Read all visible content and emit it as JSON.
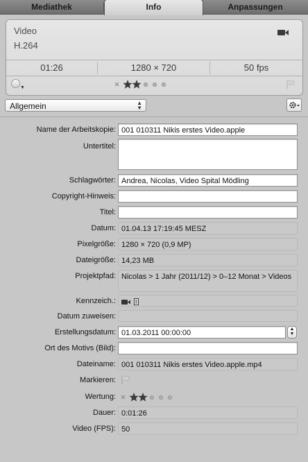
{
  "tabs": [
    "Mediathek",
    "Info",
    "Anpassungen"
  ],
  "summary": {
    "type": "Video",
    "codec": "H.264",
    "duration": "01:26",
    "resolution": "1280 × 720",
    "fps": "50 fps",
    "icons": [
      "video-camera-icon",
      "color-label-icon",
      "reject-icon",
      "star-icon",
      "flag-icon"
    ],
    "rating": 2,
    "max_rating": 5
  },
  "dropdown": {
    "selected": "Allgemein"
  },
  "fields": {
    "version_name": {
      "label": "Name der Arbeitskopie:",
      "value": "001 010311 Nikis erstes Video.apple"
    },
    "caption": {
      "label": "Untertitel:",
      "value": ""
    },
    "keywords": {
      "label": "Schlagwörter:",
      "value": "Andrea, Nicolas, Video Spital Mödling"
    },
    "copyright": {
      "label": "Copyright-Hinweis:",
      "value": ""
    },
    "title": {
      "label": "Titel:",
      "value": ""
    },
    "date": {
      "label": "Datum:",
      "value": "01.04.13 17:19:45 MESZ"
    },
    "pixel_size": {
      "label": "Pixelgröße:",
      "value": "1280 × 720 (0,9 MP)"
    },
    "file_size": {
      "label": "Dateigröße:",
      "value": "14,23 MB"
    },
    "project_path": {
      "label": "Projektpfad:",
      "value": "Nicolas > 1 Jahr (2011/12) > 0–12 Monat > Videos"
    },
    "badges": {
      "label": "Kennzeich.:"
    },
    "assign_date": {
      "label": "Datum zuweisen:",
      "value": ""
    },
    "creation_date": {
      "label": "Erstellungsdatum:",
      "value": "01.03.2011 00:00:00"
    },
    "location": {
      "label": "Ort des Motivs (Bild):",
      "value": ""
    },
    "file_name": {
      "label": "Dateiname:",
      "value": "001 010311 Nikis erstes Video.apple.mp4"
    },
    "flag": {
      "label": "Markieren:"
    },
    "rating": {
      "label": "Wertung:",
      "value": 2
    },
    "duration": {
      "label": "Dauer:",
      "value": "0:01:26"
    },
    "fps": {
      "label": "Video (FPS):",
      "value": "50"
    }
  },
  "colors": {
    "panel_bg": "#c7c7c7",
    "tab_bar": "#7a7a7a",
    "card_bg": "#e0e0e0",
    "star": "#3a3a3a"
  }
}
